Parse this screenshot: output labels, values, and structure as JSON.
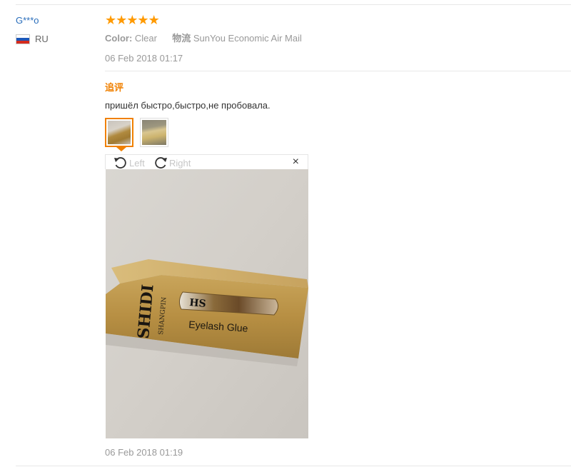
{
  "review": {
    "user_name": "G***o",
    "country": "RU",
    "rating": 5,
    "stars": [
      "★",
      "★",
      "★",
      "★",
      "★"
    ],
    "color_label": "Color:",
    "color_value": "Clear",
    "logistics_label": "物流",
    "logistics_value": "SunYou Economic Air Mail",
    "date": "06 Feb 2018 01:17",
    "followup_label": "追评",
    "followup_text": "пришёл быстро,быстро,не пробовала.",
    "followup_date": "06 Feb 2018 01:19"
  },
  "viewer": {
    "rotate_left_label": "Left",
    "rotate_right_label": "Right",
    "close_glyph": "×",
    "photo_text_brand": "SHIDI",
    "photo_text_brand_sub": "SHANGPIN",
    "photo_text_product": "Eyelash Glue"
  },
  "colors": {
    "star": "#ff9a00",
    "accent": "#f08000",
    "link": "#2a6ebb",
    "muted": "#999999"
  },
  "icons": {
    "rotate_left": "rotate-left-icon",
    "rotate_right": "rotate-right-icon",
    "flag": "russia-flag-icon"
  }
}
